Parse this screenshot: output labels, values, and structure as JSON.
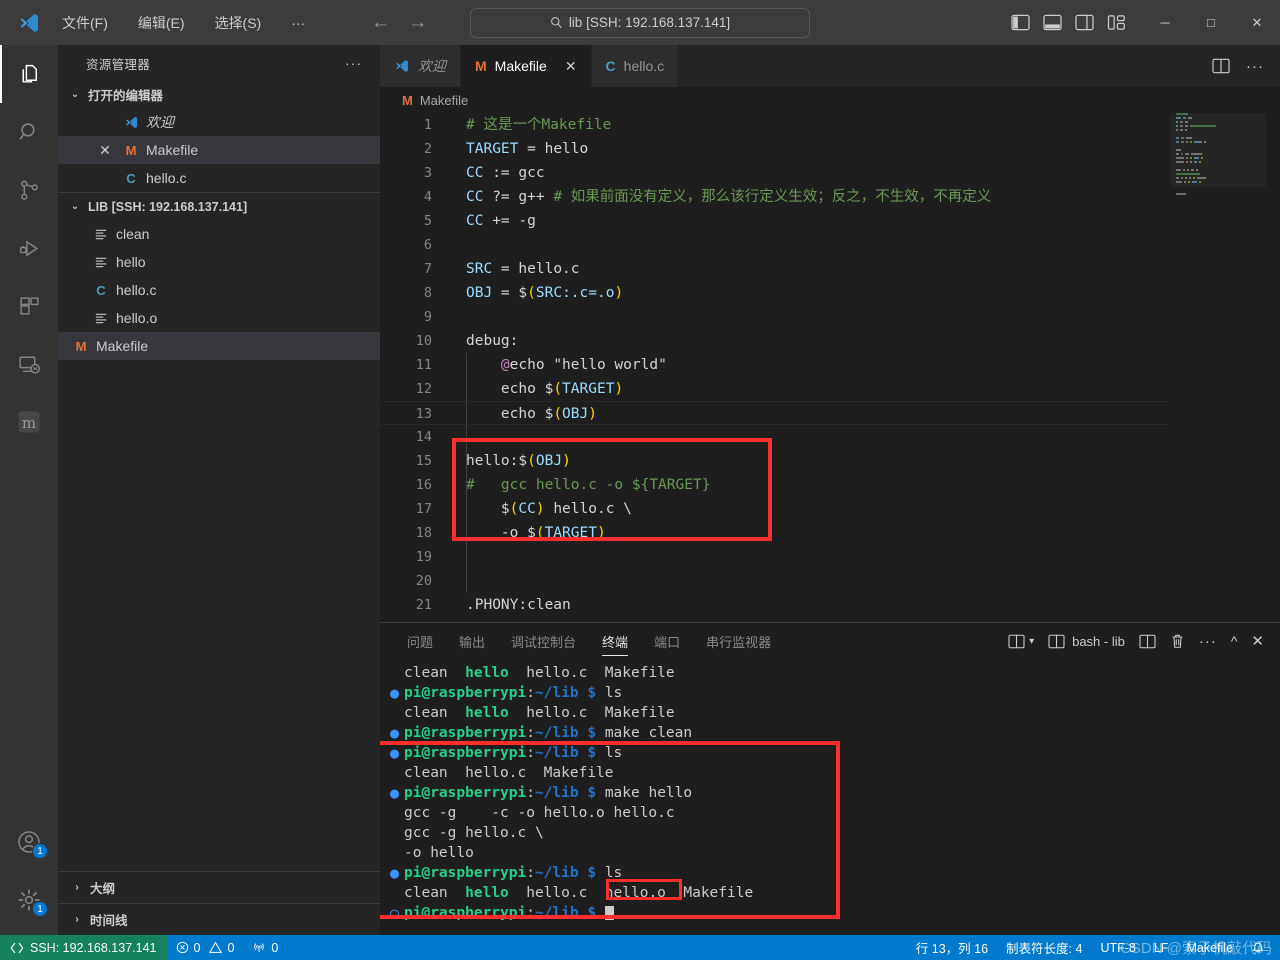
{
  "titlebar": {
    "logo_icon": "vscode-logo-icon",
    "menus": [
      {
        "label": "文件(F)",
        "name": "menu-file"
      },
      {
        "label": "编辑(E)",
        "name": "menu-edit"
      },
      {
        "label": "选择(S)",
        "name": "menu-selection"
      },
      {
        "label": "···",
        "name": "menu-more"
      }
    ],
    "nav": {
      "back": "←",
      "forward": "→"
    },
    "search": {
      "icon": "search-icon",
      "text": "lib [SSH: 192.168.137.141]"
    },
    "layout_icons": [
      "toggle-primary-sidebar-icon",
      "toggle-panel-icon",
      "toggle-secondary-sidebar-icon",
      "customize-layout-icon"
    ],
    "window_controls": {
      "minimize": "─",
      "maximize": "□",
      "close": "✕"
    }
  },
  "activitybar": {
    "items": [
      {
        "name": "activity-explorer",
        "icon": "files-icon",
        "active": true,
        "badge": ""
      },
      {
        "name": "activity-search",
        "icon": "search-icon",
        "active": false,
        "badge": ""
      },
      {
        "name": "activity-source-control",
        "icon": "source-control-icon",
        "active": false,
        "badge": ""
      },
      {
        "name": "activity-run-debug",
        "icon": "run-and-debug-icon",
        "active": false,
        "badge": ""
      },
      {
        "name": "activity-extensions",
        "icon": "extensions-icon",
        "active": false,
        "badge": ""
      },
      {
        "name": "activity-remote-explorer",
        "icon": "remote-explorer-icon",
        "active": false,
        "badge": ""
      },
      {
        "name": "activity-platformio",
        "icon": "platformio-icon",
        "active": false,
        "badge": ""
      }
    ],
    "bottom": [
      {
        "name": "activity-accounts",
        "icon": "account-icon",
        "badge": "1"
      },
      {
        "name": "activity-settings",
        "icon": "gear-icon",
        "badge": "1"
      }
    ]
  },
  "sidebar": {
    "title": "资源管理器",
    "more_actions": "···",
    "open_editors": {
      "label": "打开的编辑器",
      "chevron": "⌄",
      "items": [
        {
          "name": "open-editor-welcome",
          "label": "欢迎",
          "icon": "vscode-logo-icon",
          "icon_color": "#3b9bdd",
          "selected": false,
          "italic": true,
          "close": ""
        },
        {
          "name": "open-editor-makefile",
          "label": "Makefile",
          "icon": "M",
          "icon_color": "#e8703a",
          "selected": true,
          "italic": false,
          "close": "✕"
        },
        {
          "name": "open-editor-helloc",
          "label": "hello.c",
          "icon": "C",
          "icon_color": "#519aba",
          "selected": false,
          "italic": false,
          "close": ""
        }
      ]
    },
    "workspace": {
      "label": "LIB [SSH: 192.168.137.141]",
      "chevron": "⌄",
      "files": [
        {
          "name": "file-clean",
          "label": "clean",
          "icon": "text-file-icon",
          "icon_color": "#c5c5c5",
          "selected": false
        },
        {
          "name": "file-hello",
          "label": "hello",
          "icon": "text-file-icon",
          "icon_color": "#c5c5c5",
          "selected": false
        },
        {
          "name": "file-hello-c",
          "label": "hello.c",
          "icon": "C",
          "icon_color": "#519aba",
          "selected": false
        },
        {
          "name": "file-hello-o",
          "label": "hello.o",
          "icon": "text-file-icon",
          "icon_color": "#c5c5c5",
          "selected": false
        },
        {
          "name": "file-makefile",
          "label": "Makefile",
          "icon": "M",
          "icon_color": "#e8703a",
          "selected": true
        }
      ]
    },
    "bottom_sections": [
      {
        "name": "section-outline",
        "label": "大纲",
        "chevron": "›"
      },
      {
        "name": "section-timeline",
        "label": "时间线",
        "chevron": "›"
      }
    ]
  },
  "editor": {
    "tabs": [
      {
        "name": "tab-welcome",
        "label": "欢迎",
        "icon": "vscode-logo-icon",
        "icon_color": "#3b9bdd",
        "active": false,
        "italic": true,
        "close": ""
      },
      {
        "name": "tab-makefile",
        "label": "Makefile",
        "icon": "M",
        "icon_color": "#e8703a",
        "active": true,
        "italic": false,
        "close": "✕"
      },
      {
        "name": "tab-helloc",
        "label": "hello.c",
        "icon": "C",
        "icon_color": "#519aba",
        "active": false,
        "italic": false,
        "close": ""
      }
    ],
    "tab_actions": [
      "split-editor-icon",
      "more-actions-icon"
    ],
    "breadcrumb": {
      "icon": "M",
      "icon_color": "#e8703a",
      "label": "Makefile"
    },
    "current_line": 13,
    "lines": [
      {
        "n": 1,
        "tokens": [
          {
            "t": "# 这是一个Makefile",
            "c": "k-cmt"
          }
        ]
      },
      {
        "n": 2,
        "tokens": [
          {
            "t": "TARGET",
            "c": "k-var"
          },
          {
            "t": " = ",
            "c": "k-op"
          },
          {
            "t": "hello",
            "c": "k-pln"
          }
        ]
      },
      {
        "n": 3,
        "tokens": [
          {
            "t": "CC",
            "c": "k-var"
          },
          {
            "t": " := ",
            "c": "k-op"
          },
          {
            "t": "gcc",
            "c": "k-pln"
          }
        ]
      },
      {
        "n": 4,
        "tokens": [
          {
            "t": "CC",
            "c": "k-var"
          },
          {
            "t": " ?= ",
            "c": "k-op"
          },
          {
            "t": "g++ ",
            "c": "k-pln"
          },
          {
            "t": "# 如果前面没有定义，那么该行定义生效；反之，不生效，不再定义",
            "c": "k-cmt"
          }
        ]
      },
      {
        "n": 5,
        "tokens": [
          {
            "t": "CC",
            "c": "k-var"
          },
          {
            "t": " += ",
            "c": "k-op"
          },
          {
            "t": "-g",
            "c": "k-pln"
          }
        ]
      },
      {
        "n": 6,
        "tokens": []
      },
      {
        "n": 7,
        "tokens": [
          {
            "t": "SRC",
            "c": "k-var"
          },
          {
            "t": " = ",
            "c": "k-op"
          },
          {
            "t": "hello.c",
            "c": "k-pln"
          }
        ]
      },
      {
        "n": 8,
        "tokens": [
          {
            "t": "OBJ",
            "c": "k-var"
          },
          {
            "t": " = ",
            "c": "k-op"
          },
          {
            "t": "$",
            "c": "k-pln"
          },
          {
            "t": "(",
            "c": "k-par"
          },
          {
            "t": "SRC:.c=.o",
            "c": "k-var"
          },
          {
            "t": ")",
            "c": "k-par"
          }
        ]
      },
      {
        "n": 9,
        "tokens": []
      },
      {
        "n": 10,
        "tokens": [
          {
            "t": "debug:",
            "c": "k-pln"
          }
        ]
      },
      {
        "n": 11,
        "tokens": [
          {
            "t": "    ",
            "c": "k-pln"
          },
          {
            "t": "@",
            "c": "k-at"
          },
          {
            "t": "echo ",
            "c": "k-pln"
          },
          {
            "t": "\"hello world\"",
            "c": "k-pln"
          }
        ]
      },
      {
        "n": 12,
        "tokens": [
          {
            "t": "    echo ",
            "c": "k-pln"
          },
          {
            "t": "$",
            "c": "k-pln"
          },
          {
            "t": "(",
            "c": "k-par"
          },
          {
            "t": "TARGET",
            "c": "k-var"
          },
          {
            "t": ")",
            "c": "k-par"
          }
        ]
      },
      {
        "n": 13,
        "tokens": [
          {
            "t": "    echo ",
            "c": "k-pln"
          },
          {
            "t": "$",
            "c": "k-pln"
          },
          {
            "t": "(",
            "c": "k-par"
          },
          {
            "t": "OBJ",
            "c": "k-var"
          },
          {
            "t": ")",
            "c": "k-par"
          }
        ]
      },
      {
        "n": 14,
        "tokens": []
      },
      {
        "n": 15,
        "tokens": [
          {
            "t": "hello:",
            "c": "k-pln"
          },
          {
            "t": "$",
            "c": "k-pln"
          },
          {
            "t": "(",
            "c": "k-par"
          },
          {
            "t": "OBJ",
            "c": "k-var"
          },
          {
            "t": ")",
            "c": "k-par"
          }
        ]
      },
      {
        "n": 16,
        "tokens": [
          {
            "t": "#   gcc hello.c -o ${TARGET}",
            "c": "k-cmt"
          }
        ]
      },
      {
        "n": 17,
        "tokens": [
          {
            "t": "    ",
            "c": "k-pln"
          },
          {
            "t": "$",
            "c": "k-pln"
          },
          {
            "t": "(",
            "c": "k-par"
          },
          {
            "t": "CC",
            "c": "k-var"
          },
          {
            "t": ")",
            "c": "k-par"
          },
          {
            "t": " hello.c \\",
            "c": "k-pln"
          }
        ]
      },
      {
        "n": 18,
        "tokens": [
          {
            "t": "    -o ",
            "c": "k-pln"
          },
          {
            "t": "$",
            "c": "k-pln"
          },
          {
            "t": "(",
            "c": "k-par"
          },
          {
            "t": "TARGET",
            "c": "k-var"
          },
          {
            "t": ")",
            "c": "k-par"
          }
        ]
      },
      {
        "n": 19,
        "tokens": []
      },
      {
        "n": 20,
        "tokens": []
      },
      {
        "n": 21,
        "tokens": [
          {
            "t": ".PHONY:clean",
            "c": "k-pln"
          }
        ]
      }
    ],
    "annotation_box_label": "code-highlight-box-lines-15-18"
  },
  "panel": {
    "tabs": [
      {
        "name": "panel-tab-problems",
        "label": "问题",
        "active": false
      },
      {
        "name": "panel-tab-output",
        "label": "输出",
        "active": false
      },
      {
        "name": "panel-tab-debug-console",
        "label": "调试控制台",
        "active": false
      },
      {
        "name": "panel-tab-terminal",
        "label": "终端",
        "active": true
      },
      {
        "name": "panel-tab-ports",
        "label": "端口",
        "active": false
      },
      {
        "name": "panel-tab-serial-monitor",
        "label": "串行监视器",
        "active": false
      }
    ],
    "actions": {
      "split_dropdown_icon": "split-terminal-dropdown-icon",
      "terminal_name": "bash - lib",
      "split_icon": "split-terminal-icon",
      "kill_icon": "trash-icon",
      "more_icon": "more-actions-icon",
      "maximize_icon": "chevron-up-icon",
      "close_icon": "close-icon"
    },
    "terminal": {
      "prompt_user": "pi@raspberrypi",
      "prompt_path": "~/lib",
      "prompt_dollar": "$",
      "lines": [
        {
          "type": "output",
          "segs": [
            {
              "t": "clean  ",
              "c": "t-plain"
            },
            {
              "t": "hello",
              "c": "t-exec"
            },
            {
              "t": "  hello.c  Makefile",
              "c": "t-plain"
            }
          ]
        },
        {
          "type": "prompt",
          "cmd": "ls"
        },
        {
          "type": "output",
          "segs": [
            {
              "t": "clean  ",
              "c": "t-plain"
            },
            {
              "t": "hello",
              "c": "t-exec"
            },
            {
              "t": "  hello.c  Makefile",
              "c": "t-plain"
            }
          ]
        },
        {
          "type": "prompt",
          "cmd": "make clean"
        },
        {
          "type": "prompt",
          "cmd": "ls"
        },
        {
          "type": "output",
          "segs": [
            {
              "t": "clean  hello.c  Makefile",
              "c": "t-plain"
            }
          ]
        },
        {
          "type": "prompt",
          "cmd": "make hello"
        },
        {
          "type": "output",
          "segs": [
            {
              "t": "gcc -g    -c -o hello.o hello.c",
              "c": "t-plain"
            }
          ]
        },
        {
          "type": "output",
          "segs": [
            {
              "t": "gcc -g hello.c \\",
              "c": "t-plain"
            }
          ]
        },
        {
          "type": "output",
          "segs": [
            {
              "t": "-o hello",
              "c": "t-plain"
            }
          ]
        },
        {
          "type": "prompt",
          "cmd": "ls"
        },
        {
          "type": "output",
          "segs": [
            {
              "t": "clean  ",
              "c": "t-plain"
            },
            {
              "t": "hello",
              "c": "t-exec"
            },
            {
              "t": "  hello.c  ",
              "c": "t-plain"
            },
            {
              "t": "hello.o",
              "c": "t-plain"
            },
            {
              "t": "  Makefile",
              "c": "t-plain"
            }
          ]
        },
        {
          "type": "prompt-cursor",
          "cmd": ""
        }
      ],
      "highlight_word": "hello.o"
    }
  },
  "statusbar": {
    "remote": {
      "icon": "remote-icon",
      "label": "SSH: 192.168.137.141"
    },
    "problems": {
      "error_icon": "error-icon",
      "errors": "0",
      "warning_icon": "warning-icon",
      "warnings": "0"
    },
    "ports": {
      "icon": "radio-tower-icon",
      "count": "0"
    },
    "right": [
      {
        "name": "status-cursor-position",
        "label": "行 13，列 16"
      },
      {
        "name": "status-indentation",
        "label": "制表符长度: 4"
      },
      {
        "name": "status-encoding",
        "label": "UTF-8"
      },
      {
        "name": "status-eol",
        "label": "LF"
      },
      {
        "name": "status-language-mode",
        "label": "Makefile"
      },
      {
        "name": "status-notifications",
        "label": "🔔"
      }
    ]
  },
  "watermark": "CSDN @索子机敲代码",
  "colors": {
    "accent": "#007acc",
    "remote_green": "#16825d",
    "annotation_red": "#ff2d2d",
    "editor_bg": "#1e1e1e",
    "sidebar_bg": "#252526",
    "activitybar_bg": "#333333",
    "titlebar_bg": "#3c3c3c"
  }
}
